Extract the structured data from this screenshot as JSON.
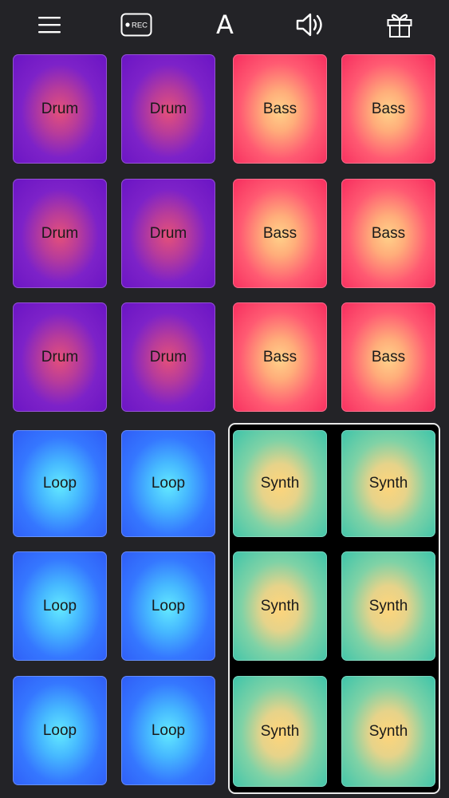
{
  "toolbar": {
    "menu_icon": "hamburger-menu-icon",
    "record_label": "REC",
    "font_label": "A",
    "sound_icon": "speaker-icon",
    "gift_icon": "gift-icon"
  },
  "colors": {
    "background": "#232327",
    "drum": "#7d22c8",
    "bass": "#f62c5e",
    "loop": "#3577ff",
    "synth": "#3cc4aa",
    "selection_border": "#e9e9e9"
  },
  "pads": {
    "drum": [
      "Drum",
      "Drum",
      "Drum",
      "Drum",
      "Drum",
      "Drum"
    ],
    "bass": [
      "Bass",
      "Bass",
      "Bass",
      "Bass",
      "Bass",
      "Bass"
    ],
    "loop": [
      "Loop",
      "Loop",
      "Loop",
      "Loop",
      "Loop",
      "Loop"
    ],
    "synth": [
      "Synth",
      "Synth",
      "Synth",
      "Synth",
      "Synth",
      "Synth"
    ]
  }
}
